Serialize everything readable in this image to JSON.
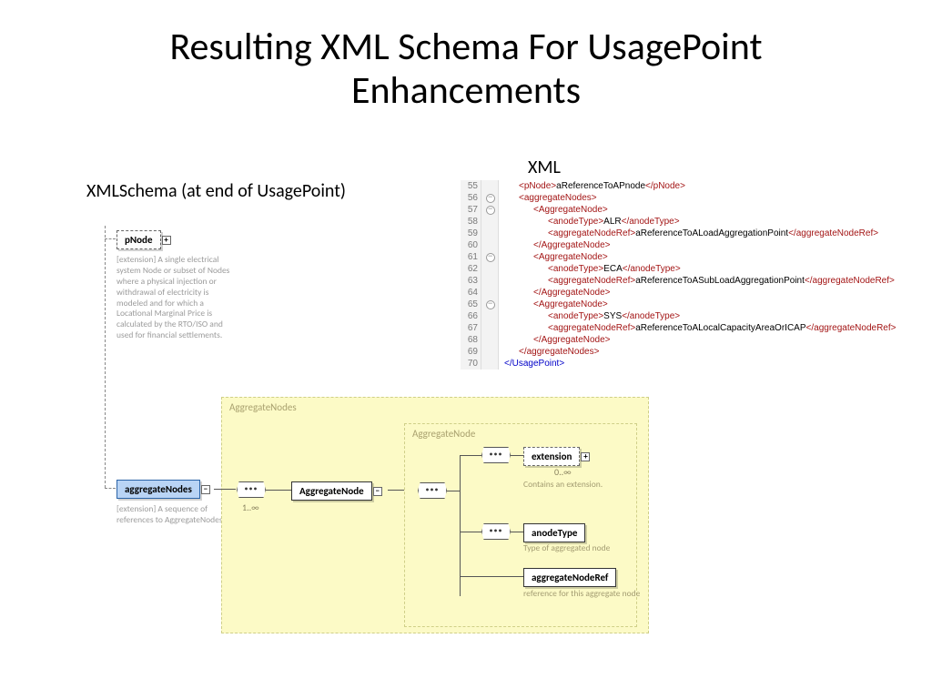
{
  "title": "Resulting XML Schema For UsagePoint Enhancements",
  "subtitle_left": "XMLSchema (at end of UsagePoint)",
  "subtitle_right": "XML",
  "tree": {
    "pnode_label": "pNode",
    "pnode_desc": "[extension] A single electrical system Node or subset of Nodes where a physical injection or withdrawal of electricity is modeled and for which a Locational Marginal Price is calculated by the RTO/ISO and used for financial settlements.",
    "agg_label": "aggregateNodes",
    "agg_desc": "[extension] A sequence of references to AggregateNodes."
  },
  "diagram": {
    "outer_label": "AggregateNodes",
    "inner_label": "AggregateNode",
    "aggregate_node": "AggregateNode",
    "extension": "extension",
    "extension_mult": "0..∞",
    "extension_desc": "Contains an extension.",
    "anode_type": "anodeType",
    "anode_type_desc": "Type of aggregated node",
    "agg_ref": "aggregateNodeRef",
    "agg_ref_desc": "reference for this aggregate node",
    "mult_left": "1..∞"
  },
  "xml": [
    {
      "n": "55",
      "fold": false,
      "ind": "i1",
      "parts": [
        {
          "c": "tag",
          "t": "<pNode>"
        },
        {
          "c": "txt",
          "t": "aReferenceToAPnode"
        },
        {
          "c": "tag",
          "t": "</pNode>"
        }
      ]
    },
    {
      "n": "56",
      "fold": true,
      "ind": "i1",
      "parts": [
        {
          "c": "tag",
          "t": "<aggregateNodes>"
        }
      ]
    },
    {
      "n": "57",
      "fold": true,
      "ind": "i2",
      "parts": [
        {
          "c": "tag",
          "t": "<AggregateNode>"
        }
      ]
    },
    {
      "n": "58",
      "fold": false,
      "ind": "i3",
      "parts": [
        {
          "c": "tag",
          "t": "<anodeType>"
        },
        {
          "c": "txt",
          "t": "ALR"
        },
        {
          "c": "tag",
          "t": "</anodeType>"
        }
      ]
    },
    {
      "n": "59",
      "fold": false,
      "ind": "i3",
      "parts": [
        {
          "c": "tag",
          "t": "<aggregateNodeRef>"
        },
        {
          "c": "txt",
          "t": "aReferenceToALoadAggregationPoint"
        },
        {
          "c": "tag",
          "t": "</aggregateNodeRef>"
        }
      ]
    },
    {
      "n": "60",
      "fold": false,
      "ind": "i2",
      "parts": [
        {
          "c": "tag",
          "t": "</AggregateNode>"
        }
      ]
    },
    {
      "n": "61",
      "fold": true,
      "ind": "i2",
      "parts": [
        {
          "c": "tag",
          "t": "<AggregateNode>"
        }
      ]
    },
    {
      "n": "62",
      "fold": false,
      "ind": "i3",
      "parts": [
        {
          "c": "tag",
          "t": "<anodeType>"
        },
        {
          "c": "txt",
          "t": "ECA"
        },
        {
          "c": "tag",
          "t": "</anodeType>"
        }
      ]
    },
    {
      "n": "63",
      "fold": false,
      "ind": "i3",
      "parts": [
        {
          "c": "tag",
          "t": "<aggregateNodeRef>"
        },
        {
          "c": "txt",
          "t": "aReferenceToASubLoadAggregationPoint"
        },
        {
          "c": "tag",
          "t": "</aggregateNodeRef>"
        }
      ]
    },
    {
      "n": "64",
      "fold": false,
      "ind": "i2",
      "parts": [
        {
          "c": "tag",
          "t": "</AggregateNode>"
        }
      ]
    },
    {
      "n": "65",
      "fold": true,
      "ind": "i2",
      "parts": [
        {
          "c": "tag",
          "t": "<AggregateNode>"
        }
      ]
    },
    {
      "n": "66",
      "fold": false,
      "ind": "i3",
      "parts": [
        {
          "c": "tag",
          "t": "<anodeType>"
        },
        {
          "c": "txt",
          "t": "SYS"
        },
        {
          "c": "tag",
          "t": "</anodeType>"
        }
      ]
    },
    {
      "n": "67",
      "fold": false,
      "ind": "i3",
      "parts": [
        {
          "c": "tag",
          "t": "<aggregateNodeRef>"
        },
        {
          "c": "txt",
          "t": "aReferenceToALocalCapacityAreaOrICAP"
        },
        {
          "c": "tag",
          "t": "</aggregateNodeRef>"
        }
      ]
    },
    {
      "n": "68",
      "fold": false,
      "ind": "i2",
      "parts": [
        {
          "c": "tag",
          "t": "</AggregateNode>"
        }
      ]
    },
    {
      "n": "69",
      "fold": false,
      "ind": "i1",
      "parts": [
        {
          "c": "tag",
          "t": "</aggregateNodes>"
        }
      ]
    },
    {
      "n": "70",
      "fold": false,
      "ind": "",
      "parts": [
        {
          "c": "blue",
          "t": "</UsagePoint>"
        }
      ]
    }
  ]
}
